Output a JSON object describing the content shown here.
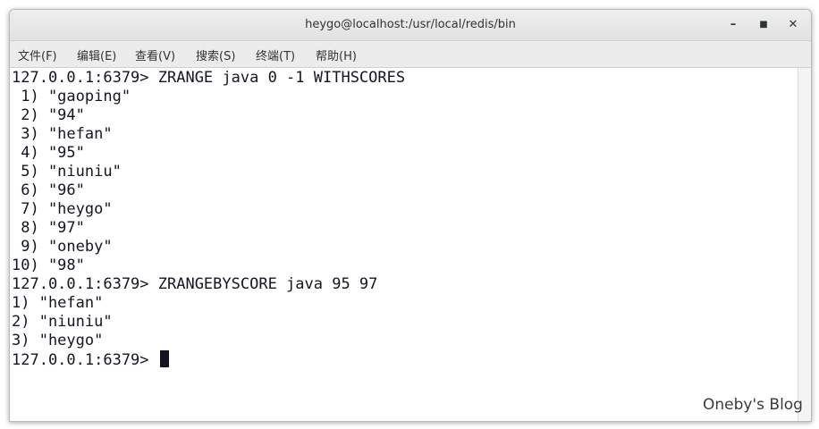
{
  "window": {
    "title": "heygo@localhost:/usr/local/redis/bin",
    "minimize_glyph": "–",
    "maximize_glyph": "■",
    "close_glyph": "✕"
  },
  "menu": [
    {
      "label": "文件(F)"
    },
    {
      "label": "编辑(E)"
    },
    {
      "label": "查看(V)"
    },
    {
      "label": "搜索(S)"
    },
    {
      "label": "终端(T)"
    },
    {
      "label": "帮助(H)"
    }
  ],
  "terminal": {
    "lines": [
      "127.0.0.1:6379> ZRANGE java 0 -1 WITHSCORES",
      " 1) \"gaoping\"",
      " 2) \"94\"",
      " 3) \"hefan\"",
      " 4) \"95\"",
      " 5) \"niuniu\"",
      " 6) \"96\"",
      " 7) \"heygo\"",
      " 8) \"97\"",
      " 9) \"oneby\"",
      "10) \"98\"",
      "127.0.0.1:6379> ZRANGEBYSCORE java 95 97",
      "1) \"hefan\"",
      "2) \"niuniu\"",
      "3) \"heygo\"",
      "127.0.0.1:6379> "
    ]
  },
  "watermark": "Oneby's Blog",
  "colors": {
    "terminal_fg": "#171421",
    "terminal_bg": "#ffffff",
    "titlebar_bg": "#e8e8e8",
    "menubar_bg": "#ececec"
  }
}
